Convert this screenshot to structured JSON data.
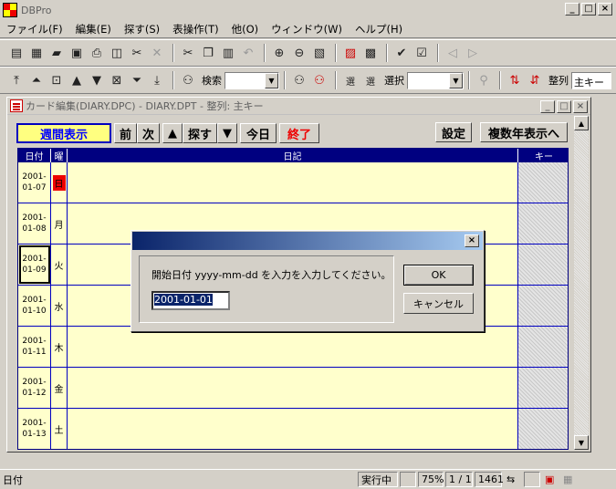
{
  "app": {
    "title": "DBPro"
  },
  "menu": [
    "ファイル(F)",
    "編集(E)",
    "探す(S)",
    "表操作(T)",
    "他(O)",
    "ウィンドウ(W)",
    "ヘルプ(H)"
  ],
  "toolbar2": {
    "search_label": "検索",
    "select_label": "選択",
    "sort_label": "整列",
    "sort_value": "主キー"
  },
  "child": {
    "title": "カード編集(DIARY.DPC) - DIARY.DPT - 整列: 主キー",
    "buttons": {
      "week": "週間表示",
      "prev": "前",
      "next": "次",
      "up": "▲",
      "search": "探す",
      "down": "▼",
      "today": "今日",
      "end": "終了",
      "settings": "設定",
      "multi_year": "複数年表示へ"
    },
    "columns": {
      "date": "日付",
      "dow": "曜",
      "diary": "日記",
      "key": "キー"
    },
    "rows": [
      {
        "date1": "2001-",
        "date2": "01-07",
        "dow": "日"
      },
      {
        "date1": "2001-",
        "date2": "01-08",
        "dow": "月"
      },
      {
        "date1": "2001-",
        "date2": "01-09",
        "dow": "火"
      },
      {
        "date1": "2001-",
        "date2": "01-10",
        "dow": "水"
      },
      {
        "date1": "2001-",
        "date2": "01-11",
        "dow": "木"
      },
      {
        "date1": "2001-",
        "date2": "01-12",
        "dow": "金"
      },
      {
        "date1": "2001-",
        "date2": "01-13",
        "dow": "土"
      }
    ]
  },
  "dialog": {
    "prompt": "開始日付 yyyy-mm-dd を入力を入力してください。",
    "input_value": "2001-01-01",
    "ok": "OK",
    "cancel": "キャンセル"
  },
  "status": {
    "field": "日付",
    "mode": "実行中",
    "zoom": "75%",
    "page": "1 / 1",
    "count": "1461"
  },
  "colors": {
    "header": "#000080",
    "grid_bg": "#ffffcc",
    "sunday": "#ee0000",
    "dialog_title": "#0a246a"
  }
}
